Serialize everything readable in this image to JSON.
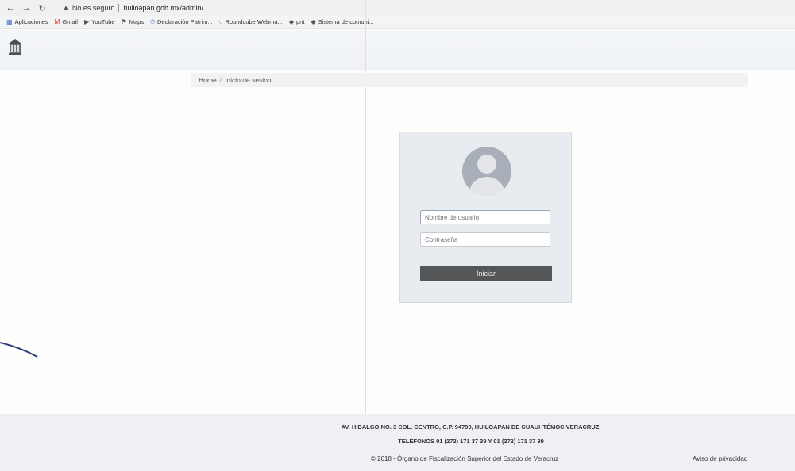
{
  "browser": {
    "security_label": "No es seguro",
    "url": "huiloapan.gob.mx/admin/"
  },
  "bookmarks": [
    {
      "label": "Aplicaciones",
      "icon": "apps-grid-icon"
    },
    {
      "label": "Gmail",
      "icon": "gmail-icon"
    },
    {
      "label": "YouTube",
      "icon": "youtube-icon"
    },
    {
      "label": "Maps",
      "icon": "maps-icon"
    },
    {
      "label": "Declaración Patrim...",
      "icon": "declaracion-icon"
    },
    {
      "label": "Roundcube Webma...",
      "icon": "roundcube-icon"
    },
    {
      "label": "pnt",
      "icon": "pnt-icon"
    },
    {
      "label": "Sistema de comuni...",
      "icon": "sistema-icon"
    }
  ],
  "breadcrumb": {
    "home": "Home",
    "current": "Inicio de sesion"
  },
  "login": {
    "username_placeholder": "Nombre de usuario",
    "password_placeholder": "Contraseña",
    "submit_label": "Iniciar"
  },
  "footer": {
    "address": "AV. HIDALGO NO. 3 COL. CENTRO, C.P. 94790, HUILOAPAN DE CUAUHTÉMOC VERACRUZ.",
    "phones": "TELÉFONOS 01 (272) 171 37 39 Y 01 (272) 171 37 39",
    "copyright": "© 2018 - Órgano de Fiscalización Superior del Estado de Veracruz",
    "privacy": "Aviso de privacidad"
  },
  "colors": {
    "button": "#545658",
    "card": "#e8ebef"
  }
}
